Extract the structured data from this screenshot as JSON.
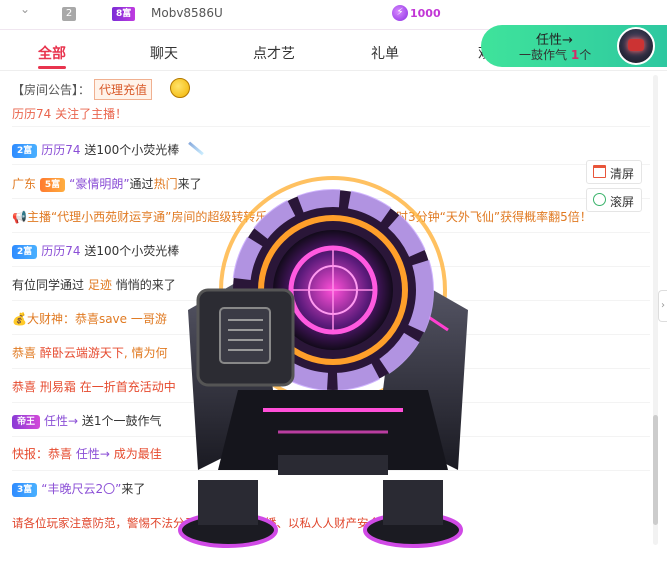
{
  "top_strip": {
    "rank": "2",
    "wealth_badge": "8富",
    "username": "Mobv8586U",
    "coin_value": "1000"
  },
  "tabs": [
    {
      "label": "全部"
    },
    {
      "label": "聊天"
    },
    {
      "label": "点才艺"
    },
    {
      "label": "礼单"
    },
    {
      "label": "观"
    }
  ],
  "popularity": {
    "name": "任性→",
    "prefix": "一鼓作气",
    "count": "1",
    "unit": "个"
  },
  "notice": {
    "label": "【房间公告】：",
    "tag": "代理充值"
  },
  "side_buttons": {
    "clear": "清屏",
    "scroll": "滚屏"
  },
  "chat": {
    "r0": {
      "text": "历历74 关注了主播！"
    },
    "r1": {
      "badge": "2富",
      "name": "历历74",
      "text": "送100个小荧光棒"
    },
    "r2": {
      "loc": "广东",
      "badge": "5富",
      "name": "“豪情明朗”",
      "via": "通过",
      "src": "热门",
      "end": "来了"
    },
    "r3": {
      "text": "主播“代理小西苑财运亨通”房间的超级转转乐",
      "tail": "限时3分钟“天外飞仙”获得概率翻5倍！"
    },
    "r4": {
      "badge": "2富",
      "name": "历历74",
      "text": "送100个小荧光棒"
    },
    "r5": {
      "pre": "有位同学通过",
      "src": "足迹",
      "text": "悄悄的来了"
    },
    "r6": {
      "pre": "大财神：恭喜save",
      "text": "一哥游"
    },
    "r7": {
      "pre": "恭喜",
      "name": "醉卧云端游天下",
      "text": "情为何"
    },
    "r8": {
      "pre": "恭喜",
      "name": "刑易霜",
      "text": "在一折首充活动中"
    },
    "r9": {
      "badge": "帝王",
      "name": "任性→",
      "text": "送1个一鼓作气"
    },
    "r10": {
      "pre": "快报：恭喜",
      "name": "任性→",
      "text": "成为最佳"
    },
    "r11": {
      "badge": "3富",
      "name": "“丰晚尺云2〇”",
      "end": "来了"
    }
  },
  "warning": "请各位玩家注意防范，警惕不法分子冒充官方、主播、以私人人财产安全！",
  "colors": {
    "accent": "#e8344e",
    "pill": "#3fe39b",
    "wealth_purple": "#8a3bd6"
  }
}
